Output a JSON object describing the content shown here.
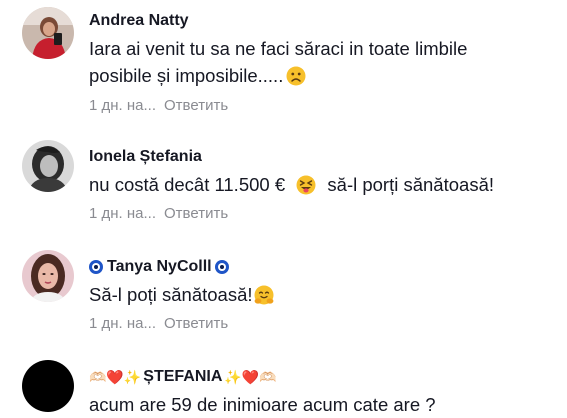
{
  "comments": [
    {
      "author": "Andrea  Natty",
      "text_line1": "Iara ai venit tu sa ne faci săraci in toate limbile",
      "text_line2": "posibile și imposibile.....",
      "emoji": "frowning-face",
      "time": "1 дн. на...",
      "reply": "Ответить"
    },
    {
      "author": "Ionela Ștefania",
      "text_part1": "nu costă decât 11.500 €",
      "text_part2": "să-l porți sănătoasă!",
      "emoji": "squinting-tongue-face",
      "time": "1 дн. на...",
      "reply": "Ответить"
    },
    {
      "author": "Tanya NyColll",
      "text": "Să-l poți sănătoasă!",
      "emoji": "hugging-face",
      "time": "1 дн. на...",
      "reply": "Ответить"
    },
    {
      "author_prefix": "🫶🏻❤️✨",
      "author": "ȘTEFANIA",
      "author_suffix": "✨❤️🫶🏻",
      "text": "acum are 59 de inimioare acum cate are ?"
    }
  ],
  "colors": {
    "text": "#161823",
    "meta": "#8a8b91",
    "emoji_yellow": "#f7c02b"
  }
}
